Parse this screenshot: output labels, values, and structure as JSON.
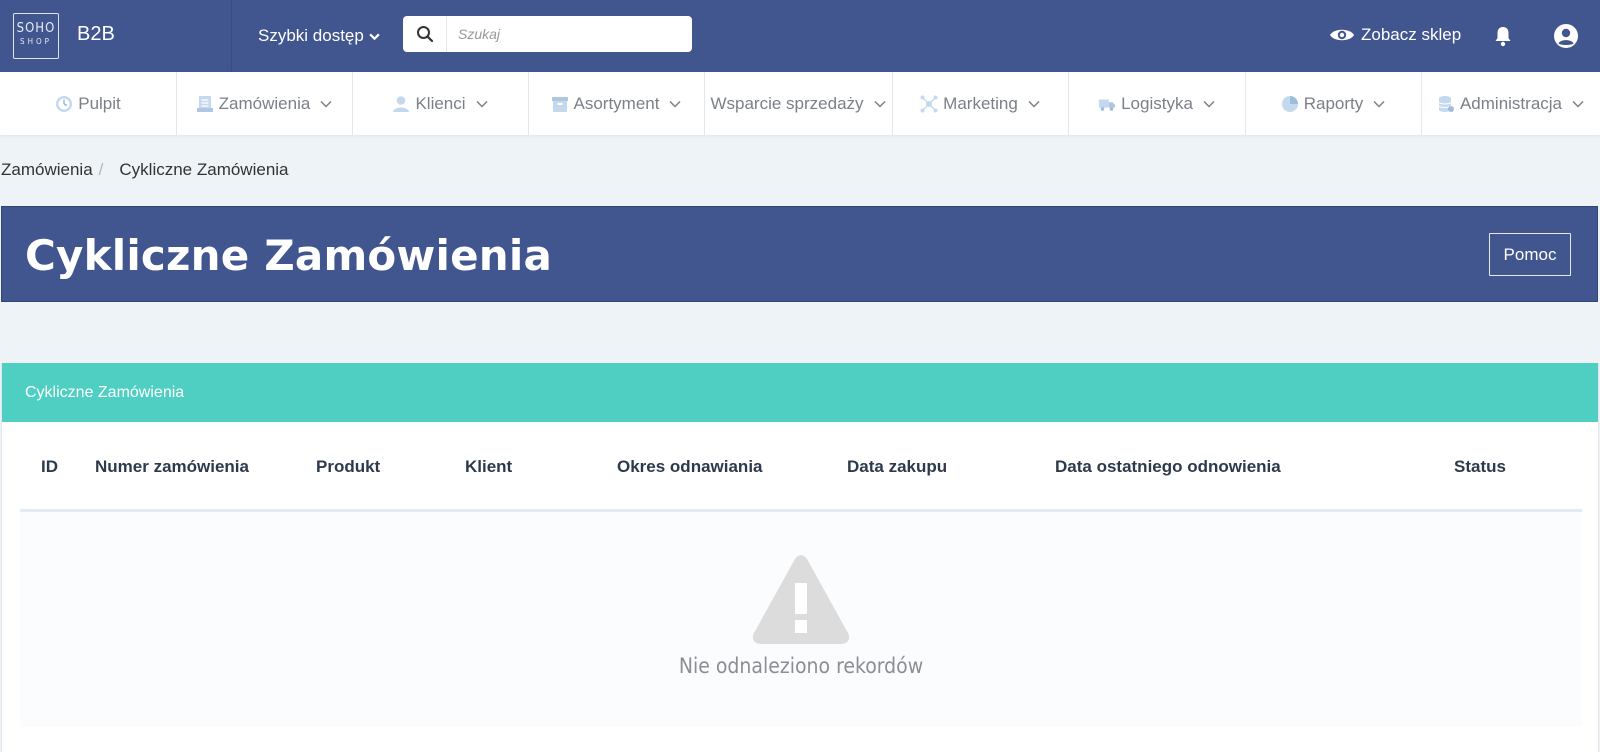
{
  "topbar": {
    "logo_line1": "SOHO",
    "logo_line2": "SHOP",
    "brand": "B2B",
    "quick_access": "Szybki dostęp",
    "search_placeholder": "Szukaj",
    "view_shop": "Zobacz sklep"
  },
  "nav": [
    {
      "label": "Pulpit",
      "icon": "dashboard-icon"
    },
    {
      "label": "Zamówienia",
      "icon": "orders-icon"
    },
    {
      "label": "Klienci",
      "icon": "user-icon"
    },
    {
      "label": "Asortyment",
      "icon": "box-icon"
    },
    {
      "label": "Wsparcie sprzedaży",
      "icon": ""
    },
    {
      "label": "Marketing",
      "icon": "network-icon"
    },
    {
      "label": "Logistyka",
      "icon": "truck-icon"
    },
    {
      "label": "Raporty",
      "icon": "pie-chart-icon"
    },
    {
      "label": "Administracja",
      "icon": "database-icon"
    }
  ],
  "breadcrumb": {
    "parent": "Zamówienia",
    "separator": "/",
    "current": "Cykliczne Zamówienia"
  },
  "page": {
    "title": "Cykliczne Zamówienia",
    "help_button": "Pomoc"
  },
  "card": {
    "title": "Cykliczne Zamówienia",
    "columns": [
      "ID",
      "Numer zamówienia",
      "Produkt",
      "Klient",
      "Okres odnawiania",
      "Data zakupu",
      "Data ostatniego odnowienia",
      "Status"
    ],
    "empty_message": "Nie odnaleziono rekordów"
  },
  "colors": {
    "header_blue": "#41558f",
    "card_teal": "#4fcec2",
    "nav_icon": "#b9cfe6"
  }
}
